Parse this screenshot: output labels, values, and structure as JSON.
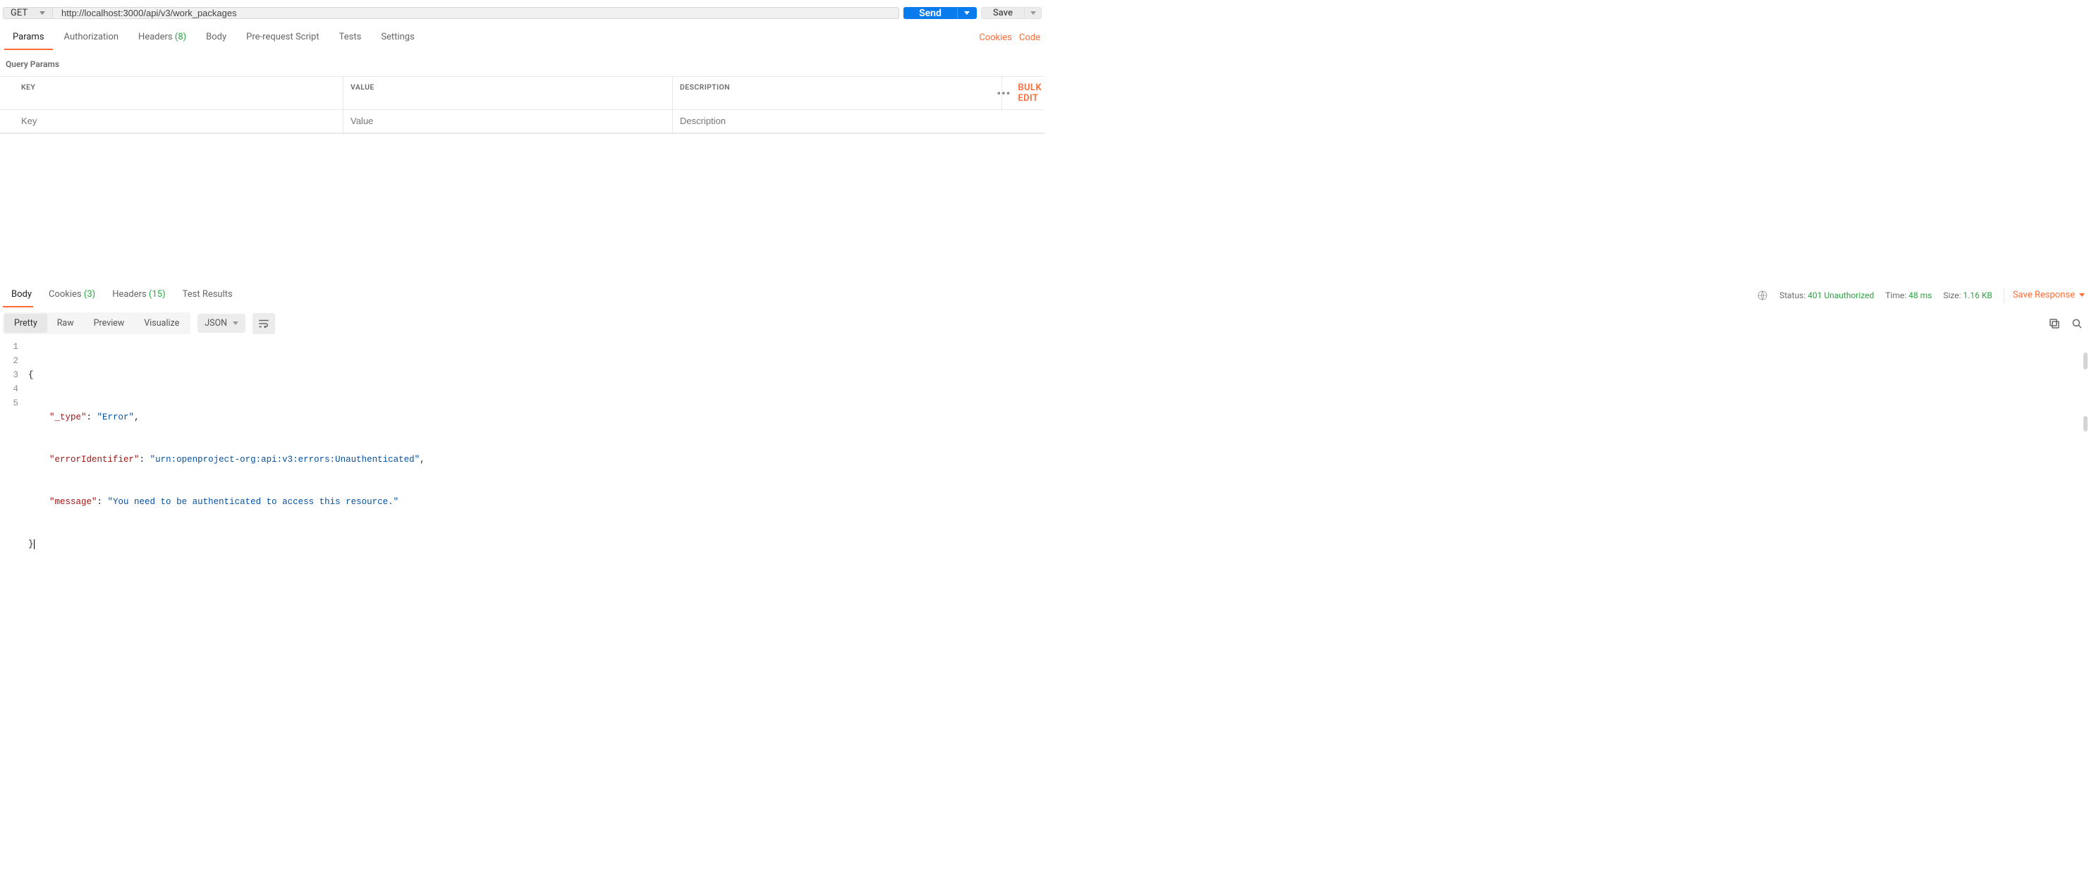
{
  "request": {
    "method": "GET",
    "url": "http://localhost:3000/api/v3/work_packages",
    "send_label": "Send",
    "save_label": "Save"
  },
  "request_tabs": {
    "items": [
      {
        "label": "Params",
        "active": true
      },
      {
        "label": "Authorization",
        "active": false
      },
      {
        "label": "Headers",
        "count": "(8)",
        "active": false
      },
      {
        "label": "Body",
        "active": false
      },
      {
        "label": "Pre-request Script",
        "active": false
      },
      {
        "label": "Tests",
        "active": false
      },
      {
        "label": "Settings",
        "active": false
      }
    ],
    "right_links": {
      "cookies": "Cookies",
      "code": "Code"
    }
  },
  "query_params": {
    "section_title": "Query Params",
    "columns": {
      "key": "KEY",
      "value": "VALUE",
      "description": "DESCRIPTION"
    },
    "bulk_edit": "Bulk Edit",
    "placeholders": {
      "key": "Key",
      "value": "Value",
      "description": "Description"
    }
  },
  "response_tabs": {
    "items": [
      {
        "label": "Body",
        "active": true
      },
      {
        "label": "Cookies",
        "count": "(3)",
        "active": false
      },
      {
        "label": "Headers",
        "count": "(15)",
        "active": false
      },
      {
        "label": "Test Results",
        "active": false
      }
    ]
  },
  "response_meta": {
    "status_label": "Status:",
    "status_value": "401 Unauthorized",
    "time_label": "Time:",
    "time_value": "48 ms",
    "size_label": "Size:",
    "size_value": "1.16 KB",
    "save_response": "Save Response"
  },
  "body_view": {
    "modes": [
      {
        "label": "Pretty",
        "active": true
      },
      {
        "label": "Raw",
        "active": false
      },
      {
        "label": "Preview",
        "active": false
      },
      {
        "label": "Visualize",
        "active": false
      }
    ],
    "format": "JSON"
  },
  "code_lines": [
    {
      "n": "1",
      "raw": "{"
    },
    {
      "n": "2",
      "indent": "    ",
      "key": "\"_type\"",
      "sep": ": ",
      "val": "\"Error\"",
      "tail": ","
    },
    {
      "n": "3",
      "indent": "    ",
      "key": "\"errorIdentifier\"",
      "sep": ": ",
      "val": "\"urn:openproject-org:api:v3:errors:Unauthenticated\"",
      "tail": ","
    },
    {
      "n": "4",
      "indent": "    ",
      "key": "\"message\"",
      "sep": ": ",
      "val": "\"You need to be authenticated to access this resource.\"",
      "tail": ""
    },
    {
      "n": "5",
      "raw": "}"
    }
  ]
}
